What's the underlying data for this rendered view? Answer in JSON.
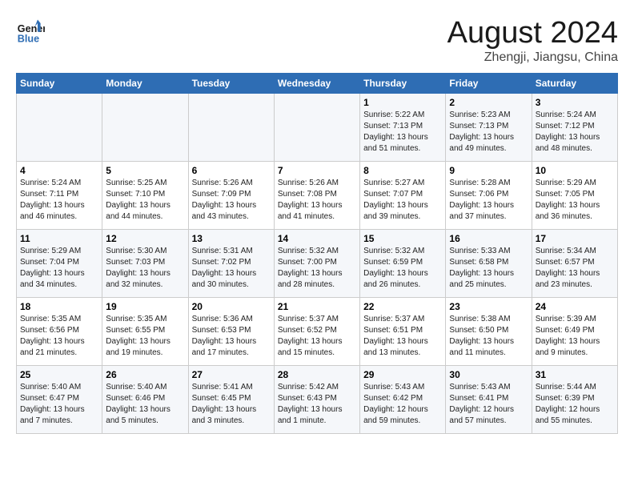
{
  "logo": {
    "line1": "General",
    "line2": "Blue"
  },
  "title": "August 2024",
  "subtitle": "Zhengji, Jiangsu, China",
  "days_of_week": [
    "Sunday",
    "Monday",
    "Tuesday",
    "Wednesday",
    "Thursday",
    "Friday",
    "Saturday"
  ],
  "weeks": [
    [
      {
        "num": "",
        "info": ""
      },
      {
        "num": "",
        "info": ""
      },
      {
        "num": "",
        "info": ""
      },
      {
        "num": "",
        "info": ""
      },
      {
        "num": "1",
        "info": "Sunrise: 5:22 AM\nSunset: 7:13 PM\nDaylight: 13 hours\nand 51 minutes."
      },
      {
        "num": "2",
        "info": "Sunrise: 5:23 AM\nSunset: 7:13 PM\nDaylight: 13 hours\nand 49 minutes."
      },
      {
        "num": "3",
        "info": "Sunrise: 5:24 AM\nSunset: 7:12 PM\nDaylight: 13 hours\nand 48 minutes."
      }
    ],
    [
      {
        "num": "4",
        "info": "Sunrise: 5:24 AM\nSunset: 7:11 PM\nDaylight: 13 hours\nand 46 minutes."
      },
      {
        "num": "5",
        "info": "Sunrise: 5:25 AM\nSunset: 7:10 PM\nDaylight: 13 hours\nand 44 minutes."
      },
      {
        "num": "6",
        "info": "Sunrise: 5:26 AM\nSunset: 7:09 PM\nDaylight: 13 hours\nand 43 minutes."
      },
      {
        "num": "7",
        "info": "Sunrise: 5:26 AM\nSunset: 7:08 PM\nDaylight: 13 hours\nand 41 minutes."
      },
      {
        "num": "8",
        "info": "Sunrise: 5:27 AM\nSunset: 7:07 PM\nDaylight: 13 hours\nand 39 minutes."
      },
      {
        "num": "9",
        "info": "Sunrise: 5:28 AM\nSunset: 7:06 PM\nDaylight: 13 hours\nand 37 minutes."
      },
      {
        "num": "10",
        "info": "Sunrise: 5:29 AM\nSunset: 7:05 PM\nDaylight: 13 hours\nand 36 minutes."
      }
    ],
    [
      {
        "num": "11",
        "info": "Sunrise: 5:29 AM\nSunset: 7:04 PM\nDaylight: 13 hours\nand 34 minutes."
      },
      {
        "num": "12",
        "info": "Sunrise: 5:30 AM\nSunset: 7:03 PM\nDaylight: 13 hours\nand 32 minutes."
      },
      {
        "num": "13",
        "info": "Sunrise: 5:31 AM\nSunset: 7:02 PM\nDaylight: 13 hours\nand 30 minutes."
      },
      {
        "num": "14",
        "info": "Sunrise: 5:32 AM\nSunset: 7:00 PM\nDaylight: 13 hours\nand 28 minutes."
      },
      {
        "num": "15",
        "info": "Sunrise: 5:32 AM\nSunset: 6:59 PM\nDaylight: 13 hours\nand 26 minutes."
      },
      {
        "num": "16",
        "info": "Sunrise: 5:33 AM\nSunset: 6:58 PM\nDaylight: 13 hours\nand 25 minutes."
      },
      {
        "num": "17",
        "info": "Sunrise: 5:34 AM\nSunset: 6:57 PM\nDaylight: 13 hours\nand 23 minutes."
      }
    ],
    [
      {
        "num": "18",
        "info": "Sunrise: 5:35 AM\nSunset: 6:56 PM\nDaylight: 13 hours\nand 21 minutes."
      },
      {
        "num": "19",
        "info": "Sunrise: 5:35 AM\nSunset: 6:55 PM\nDaylight: 13 hours\nand 19 minutes."
      },
      {
        "num": "20",
        "info": "Sunrise: 5:36 AM\nSunset: 6:53 PM\nDaylight: 13 hours\nand 17 minutes."
      },
      {
        "num": "21",
        "info": "Sunrise: 5:37 AM\nSunset: 6:52 PM\nDaylight: 13 hours\nand 15 minutes."
      },
      {
        "num": "22",
        "info": "Sunrise: 5:37 AM\nSunset: 6:51 PM\nDaylight: 13 hours\nand 13 minutes."
      },
      {
        "num": "23",
        "info": "Sunrise: 5:38 AM\nSunset: 6:50 PM\nDaylight: 13 hours\nand 11 minutes."
      },
      {
        "num": "24",
        "info": "Sunrise: 5:39 AM\nSunset: 6:49 PM\nDaylight: 13 hours\nand 9 minutes."
      }
    ],
    [
      {
        "num": "25",
        "info": "Sunrise: 5:40 AM\nSunset: 6:47 PM\nDaylight: 13 hours\nand 7 minutes."
      },
      {
        "num": "26",
        "info": "Sunrise: 5:40 AM\nSunset: 6:46 PM\nDaylight: 13 hours\nand 5 minutes."
      },
      {
        "num": "27",
        "info": "Sunrise: 5:41 AM\nSunset: 6:45 PM\nDaylight: 13 hours\nand 3 minutes."
      },
      {
        "num": "28",
        "info": "Sunrise: 5:42 AM\nSunset: 6:43 PM\nDaylight: 13 hours\nand 1 minute."
      },
      {
        "num": "29",
        "info": "Sunrise: 5:43 AM\nSunset: 6:42 PM\nDaylight: 12 hours\nand 59 minutes."
      },
      {
        "num": "30",
        "info": "Sunrise: 5:43 AM\nSunset: 6:41 PM\nDaylight: 12 hours\nand 57 minutes."
      },
      {
        "num": "31",
        "info": "Sunrise: 5:44 AM\nSunset: 6:39 PM\nDaylight: 12 hours\nand 55 minutes."
      }
    ]
  ]
}
